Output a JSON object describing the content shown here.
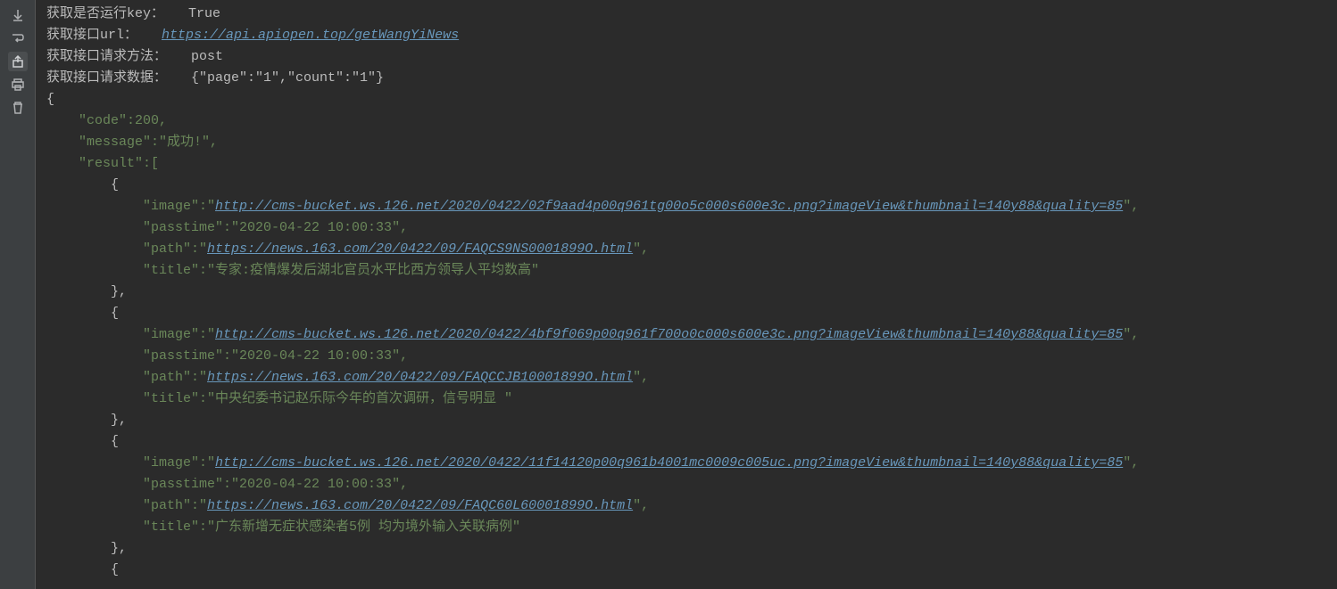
{
  "gutter": {
    "icons": [
      "scroll-down",
      "wrap",
      "export",
      "print",
      "delete"
    ]
  },
  "log": {
    "l1_label": "获取是否运行key：   ",
    "l1_value": "True",
    "l2_label": "获取接口url：   ",
    "l2_url": "https://api.apiopen.top/getWangYiNews",
    "l3_label": "获取接口请求方法：   ",
    "l3_value": "post",
    "l4_label": "获取接口请求数据：   ",
    "l4_value": "{\"page\":\"1\",\"count\":\"1\"}"
  },
  "json": {
    "open": "{",
    "code_line": "    \"code\":200,",
    "message_line": "    \"message\":\"成功!\",",
    "result_open": "    \"result\":[",
    "item_open": "        {",
    "item_close": "        },",
    "image_key": "            \"image\":\"",
    "image_close": "\",",
    "passtime": "            \"passtime\":\"2020-04-22 10:00:33\",",
    "path_key": "            \"path\":\"",
    "path_close": "\",",
    "title_key": "            \"title\":\"",
    "title_close": "\"",
    "items": [
      {
        "image": "http://cms-bucket.ws.126.net/2020/0422/02f9aad4p00q961tg00o5c000s600e3c.png?imageView&thumbnail=140y88&quality=85",
        "path": "https://news.163.com/20/0422/09/FAQCS9NS0001899O.html",
        "title": "专家:疫情爆发后湖北官员水平比西方领导人平均数高"
      },
      {
        "image": "http://cms-bucket.ws.126.net/2020/0422/4bf9f069p00q961f700o0c000s600e3c.png?imageView&thumbnail=140y88&quality=85",
        "path": "https://news.163.com/20/0422/09/FAQCCJB10001899O.html",
        "title": "中央纪委书记赵乐际今年的首次调研，信号明显 "
      },
      {
        "image": "http://cms-bucket.ws.126.net/2020/0422/11f14120p00q961b4001mc0009c005uc.png?imageView&thumbnail=140y88&quality=85",
        "path": "https://news.163.com/20/0422/09/FAQC60L60001899O.html",
        "title": "广东新增无症状感染者5例 均为境外输入关联病例"
      }
    ]
  }
}
